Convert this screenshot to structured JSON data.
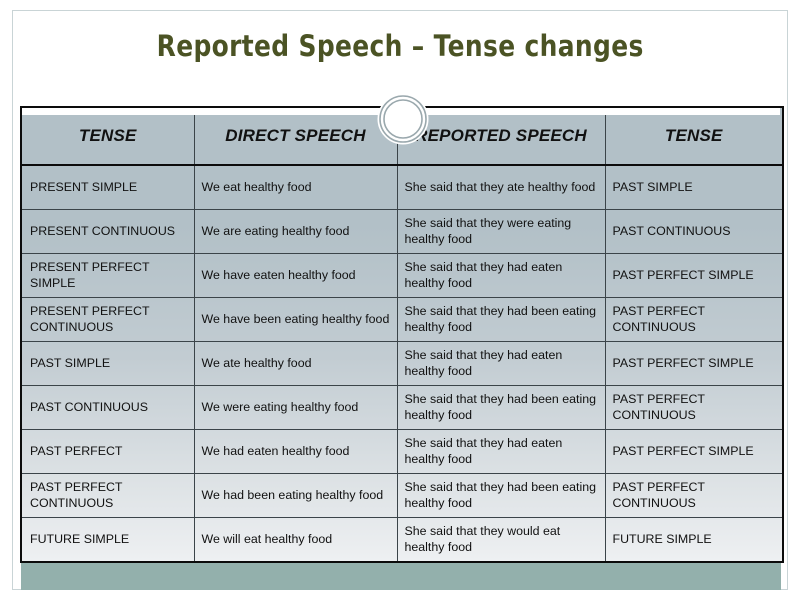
{
  "slide": {
    "title": "Reported Speech – Tense changes",
    "title_color": "#4b5324",
    "footer_color": "#93b0ac",
    "table_header_color": "#b2c0c7",
    "table_border_color": "#0c0c0c",
    "decoration": "double-ring-circle"
  },
  "table": {
    "headers": [
      "TENSE",
      "DIRECT SPEECH",
      "REPORTED SPEECH",
      "TENSE"
    ],
    "rows": [
      {
        "tense_from": "PRESENT SIMPLE",
        "direct_speech": "We eat healthy food",
        "reported_speech": "She said that they ate healthy food",
        "tense_to": "PAST SIMPLE"
      },
      {
        "tense_from": "PRESENT CONTINUOUS",
        "direct_speech": "We are eating healthy food",
        "reported_speech": "She said that they were eating healthy food",
        "tense_to": "PAST CONTINUOUS"
      },
      {
        "tense_from": "PRESENT PERFECT SIMPLE",
        "direct_speech": "We have eaten healthy food",
        "reported_speech": "She said that they had eaten healthy food",
        "tense_to": "PAST PERFECT SIMPLE"
      },
      {
        "tense_from": "PRESENT PERFECT CONTINUOUS",
        "direct_speech": "We have been eating healthy food",
        "reported_speech": "She said that they had been eating  healthy food",
        "tense_to": "PAST PERFECT CONTINUOUS"
      },
      {
        "tense_from": "PAST SIMPLE",
        "direct_speech": "We ate healthy food",
        "reported_speech": "She said that they had eaten healthy food",
        "tense_to": "PAST PERFECT SIMPLE"
      },
      {
        "tense_from": "PAST CONTINUOUS",
        "direct_speech": "We were eating healthy food",
        "reported_speech": "She said that they had been eating healthy food",
        "tense_to": "PAST PERFECT CONTINUOUS"
      },
      {
        "tense_from": "PAST PERFECT",
        "direct_speech": "We had eaten healthy food",
        "reported_speech": "She said that they had eaten healthy food",
        "tense_to": "PAST PERFECT SIMPLE"
      },
      {
        "tense_from": "PAST PERFECT CONTINUOUS",
        "direct_speech": "We had been eating healthy food",
        "reported_speech": "She said that they had been eating  healthy food",
        "tense_to": "PAST PERFECT CONTINUOUS"
      },
      {
        "tense_from": "FUTURE SIMPLE",
        "direct_speech": "We will eat healthy food",
        "reported_speech": "She said that they would eat healthy food",
        "tense_to": "FUTURE SIMPLE"
      }
    ]
  }
}
